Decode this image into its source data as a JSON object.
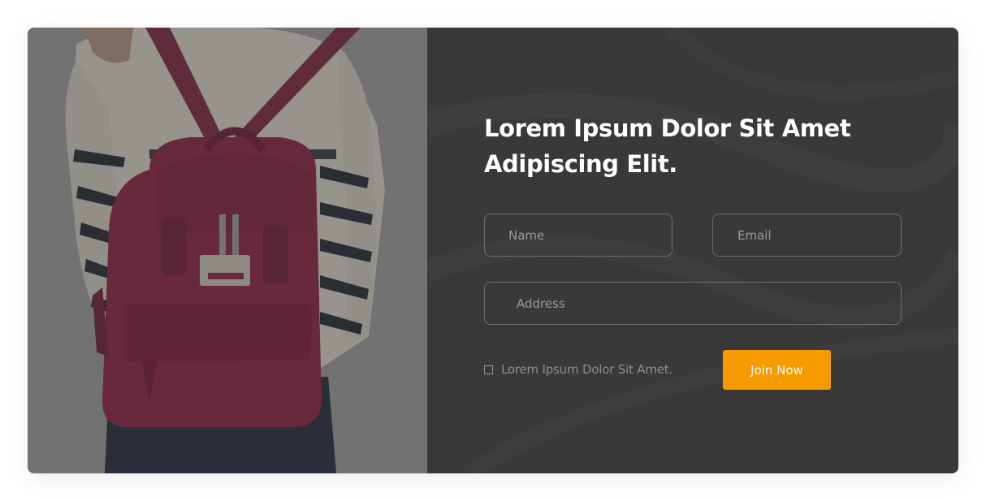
{
  "hero_image": {
    "subject": "person-wearing-red-backpack"
  },
  "form": {
    "heading": "Lorem Ipsum Dolor Sit Amet Adipiscing Elit.",
    "name_placeholder": "Name",
    "email_placeholder": "Email",
    "address_placeholder": "Address",
    "consent_label": "Lorem Ipsum Dolor Sit Amet.",
    "submit_label": "Join Now"
  },
  "colors": {
    "panel_background": "#393939",
    "accent": "#f59a00",
    "field_border": "#6e6e6e",
    "heading_text": "#ffffff"
  }
}
